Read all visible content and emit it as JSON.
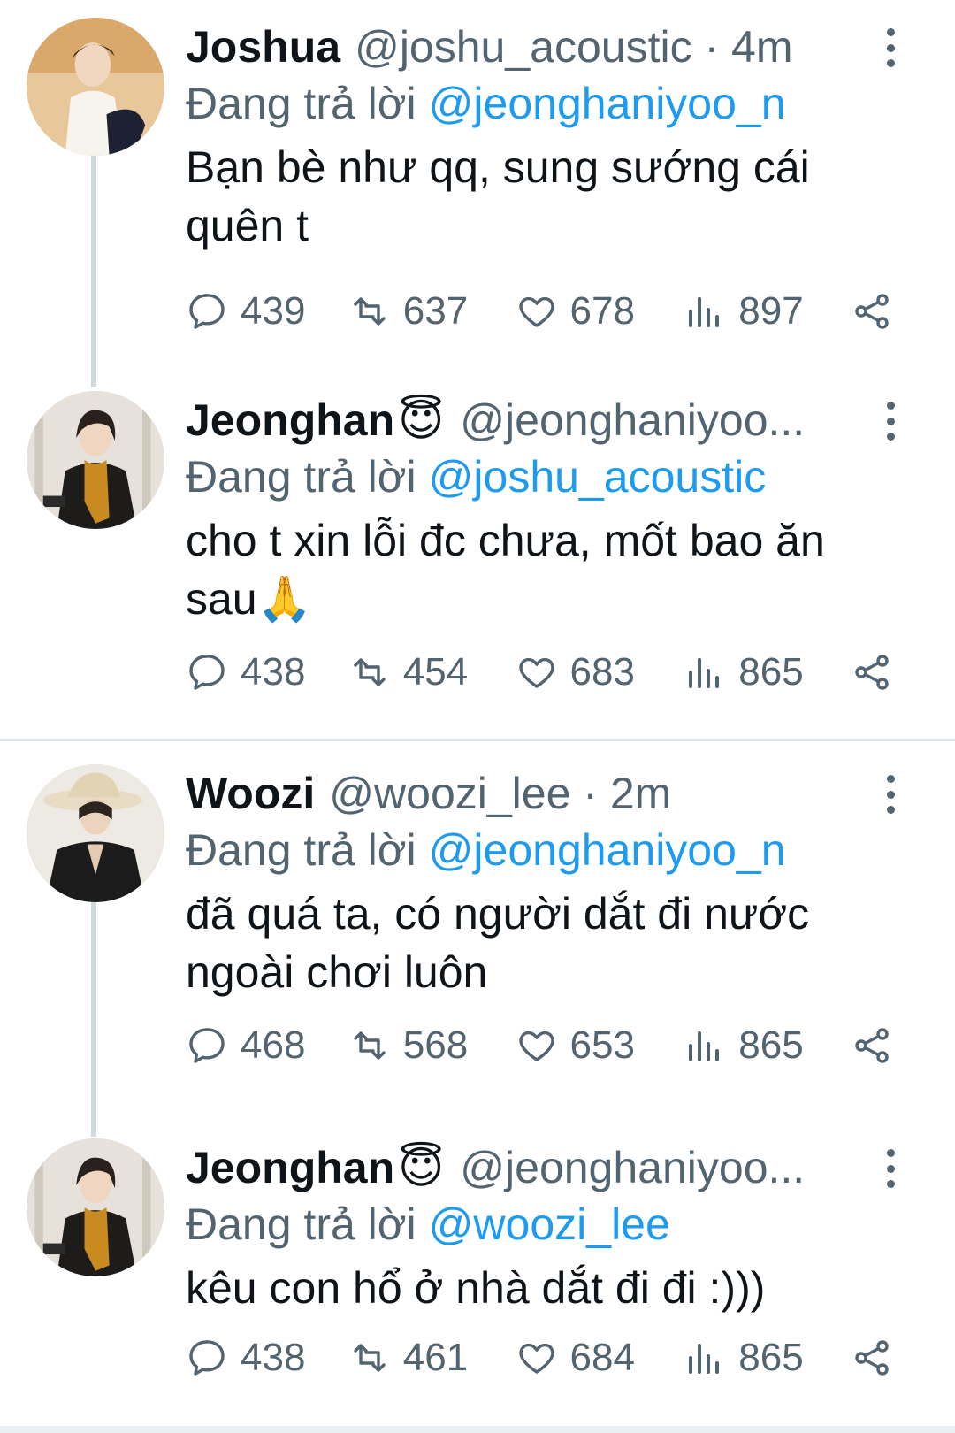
{
  "tweets": [
    {
      "name": "Joshua",
      "handle": "@joshu_acoustic · 4m",
      "emoji": "",
      "reply_prefix": "Đang trả lời",
      "reply_to": "@jeonghaniyoo_n",
      "text_lines": [
        "Bạn bè như qq, sung sướng cái",
        "quên t"
      ],
      "stats": {
        "replies": "439",
        "retweets": "637",
        "likes": "678",
        "views": "897"
      }
    },
    {
      "name": "Jeonghan",
      "handle": "@jeonghaniyoo...",
      "emoji": "😇",
      "reply_prefix": "Đang trả lời",
      "reply_to": "@joshu_acoustic",
      "text_lines": [
        "cho t xin lỗi đc chưa, mốt bao ăn",
        "sau🙏"
      ],
      "stats": {
        "replies": "438",
        "retweets": "454",
        "likes": "683",
        "views": "865"
      }
    },
    {
      "name": "Woozi",
      "handle": "@woozi_lee · 2m",
      "emoji": "",
      "reply_prefix": "Đang trả lời",
      "reply_to": "@jeonghaniyoo_n",
      "text_lines": [
        "đã quá ta, có người dắt đi nước",
        "ngoài chơi luôn"
      ],
      "stats": {
        "replies": "468",
        "retweets": "568",
        "likes": "653",
        "views": "865"
      }
    },
    {
      "name": "Jeonghan",
      "handle": "@jeonghaniyoo...",
      "emoji": "😇",
      "reply_prefix": "Đang trả lời",
      "reply_to": "@woozi_lee",
      "text_lines": [
        "kêu con hổ ở nhà dắt đi đi :)))"
      ],
      "stats": {
        "replies": "438",
        "retweets": "461",
        "likes": "684",
        "views": "865"
      }
    }
  ],
  "icons": [
    "more-options-icon",
    "reply-icon",
    "retweet-icon",
    "like-icon",
    "views-icon",
    "share-icon"
  ],
  "colors": {
    "link": "#1d9bf0",
    "muted": "#536471",
    "text": "#0f1419",
    "thread_line": "#cfd9de"
  }
}
